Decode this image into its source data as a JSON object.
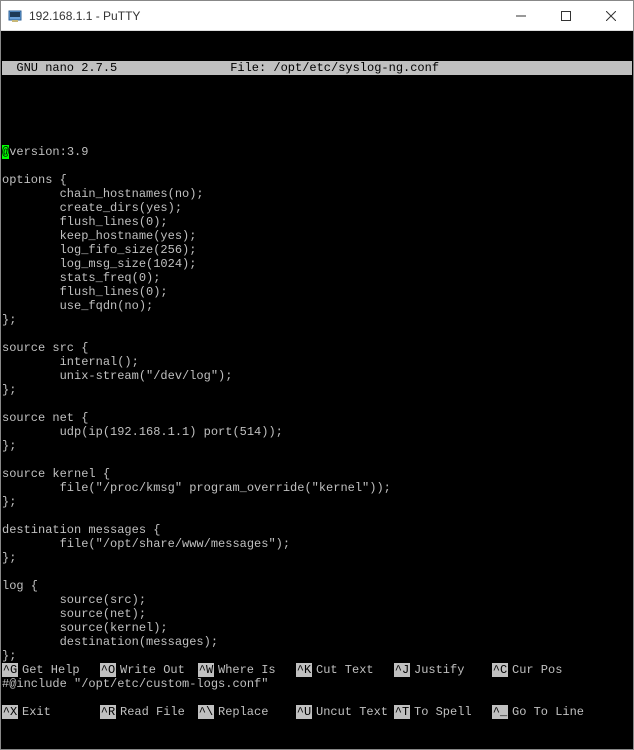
{
  "window": {
    "title": "192.168.1.1 - PuTTY"
  },
  "editor": {
    "app": "  GNU nano 2.7.5",
    "file_label": "File: /opt/etc/syslog-ng.conf"
  },
  "lines": [
    "@version:3.9",
    "",
    "options {",
    "        chain_hostnames(no);",
    "        create_dirs(yes);",
    "        flush_lines(0);",
    "        keep_hostname(yes);",
    "        log_fifo_size(256);",
    "        log_msg_size(1024);",
    "        stats_freq(0);",
    "        flush_lines(0);",
    "        use_fqdn(no);",
    "};",
    "",
    "source src {",
    "        internal();",
    "        unix-stream(\"/dev/log\");",
    "};",
    "",
    "source net {",
    "        udp(ip(192.168.1.1) port(514));",
    "};",
    "",
    "source kernel {",
    "        file(\"/proc/kmsg\" program_override(\"kernel\"));",
    "};",
    "",
    "destination messages {",
    "        file(\"/opt/share/www/messages\");",
    "};",
    "",
    "log {",
    "        source(src);",
    "        source(net);",
    "        source(kernel);",
    "        destination(messages);",
    "};",
    "",
    "#@include \"/opt/etc/custom-logs.conf\""
  ],
  "footer": {
    "row1": [
      {
        "key": "^G",
        "label": "Get Help"
      },
      {
        "key": "^O",
        "label": "Write Out"
      },
      {
        "key": "^W",
        "label": "Where Is"
      },
      {
        "key": "^K",
        "label": "Cut Text"
      },
      {
        "key": "^J",
        "label": "Justify"
      },
      {
        "key": "^C",
        "label": "Cur Pos"
      }
    ],
    "row2": [
      {
        "key": "^X",
        "label": "Exit"
      },
      {
        "key": "^R",
        "label": "Read File"
      },
      {
        "key": "^\\",
        "label": "Replace"
      },
      {
        "key": "^U",
        "label": "Uncut Text"
      },
      {
        "key": "^T",
        "label": "To Spell"
      },
      {
        "key": "^_",
        "label": "Go To Line"
      }
    ]
  }
}
